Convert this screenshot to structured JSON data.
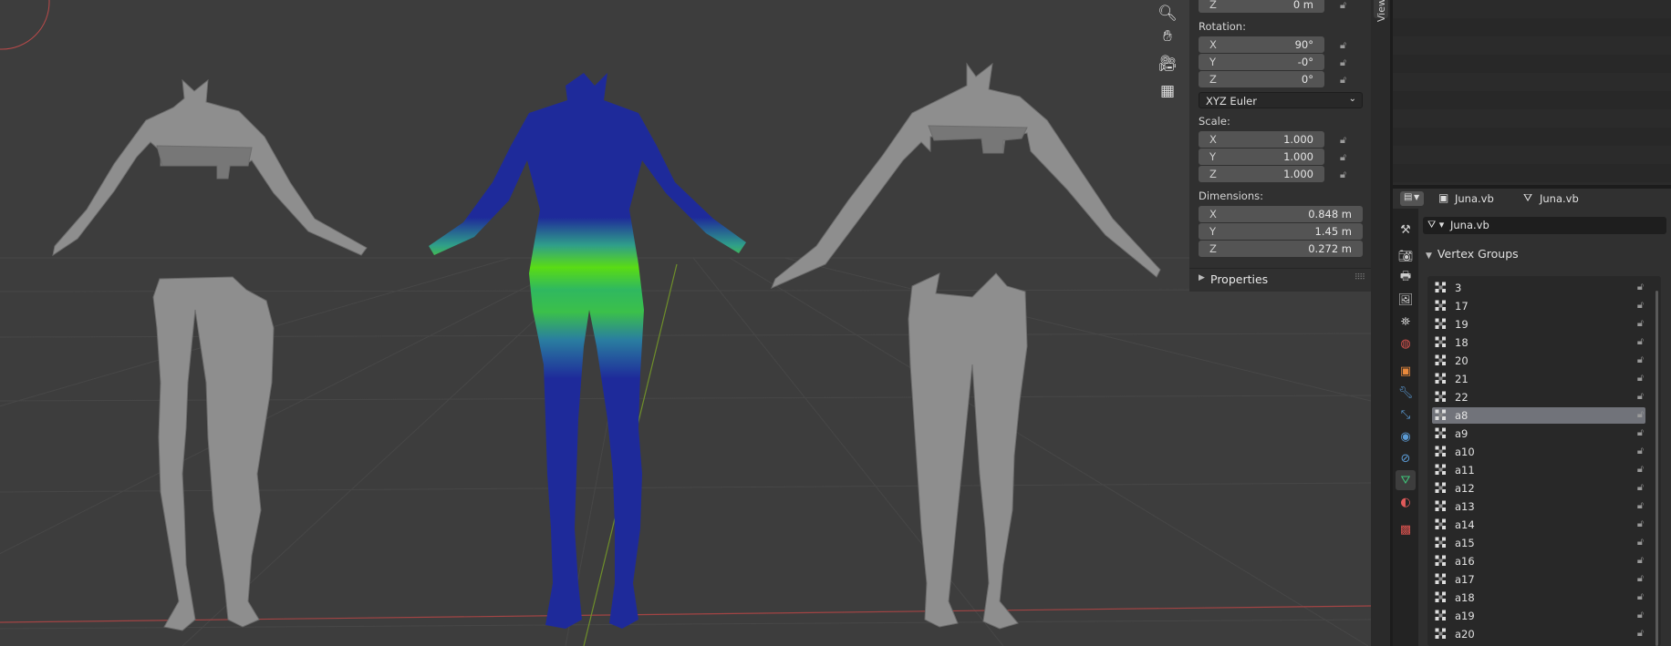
{
  "viewport": {
    "tools": [
      "zoom-icon",
      "hand-icon",
      "camera-icon",
      "grid-icon"
    ]
  },
  "npanel": {
    "location_z": {
      "axis": "Z",
      "value": "0 m"
    },
    "rotation_label": "Rotation:",
    "rotation": [
      {
        "axis": "X",
        "value": "90°"
      },
      {
        "axis": "Y",
        "value": "-0°"
      },
      {
        "axis": "Z",
        "value": "0°"
      }
    ],
    "rotation_mode": "XYZ Euler",
    "scale_label": "Scale:",
    "scale": [
      {
        "axis": "X",
        "value": "1.000"
      },
      {
        "axis": "Y",
        "value": "1.000"
      },
      {
        "axis": "Z",
        "value": "1.000"
      }
    ],
    "dimensions_label": "Dimensions:",
    "dimensions": [
      {
        "axis": "X",
        "value": "0.848 m"
      },
      {
        "axis": "Y",
        "value": "1.45 m"
      },
      {
        "axis": "Z",
        "value": "0.272 m"
      }
    ],
    "properties_label": "Properties"
  },
  "view_tab": "View",
  "properties_header": {
    "object_name": "Juna.vb",
    "mesh_name": "Juna.vb"
  },
  "mesh_data_name": "Juna.vb",
  "vertex_groups": {
    "title": "Vertex Groups",
    "items": [
      "3",
      "17",
      "19",
      "18",
      "20",
      "21",
      "22",
      "a8",
      "a9",
      "a10",
      "a11",
      "a12",
      "a13",
      "a14",
      "a15",
      "a16",
      "a17",
      "a18",
      "a19",
      "a20"
    ],
    "selected": "a8"
  },
  "colors": {
    "viewport_bg": "#3d3d3d",
    "panel_bg": "#303030",
    "selected_row": "#71737a",
    "weight_low": "#1e2a9a",
    "weight_high": "#5adc14"
  }
}
